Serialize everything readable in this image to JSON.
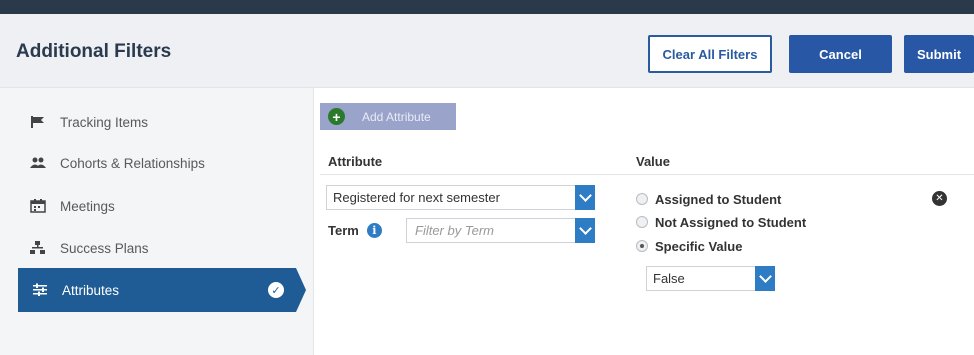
{
  "header": {
    "title": "Additional Filters",
    "clear_label": "Clear All Filters",
    "cancel_label": "Cancel",
    "submit_label": "Submit"
  },
  "sidebar": {
    "items": [
      {
        "label": "Tracking Items",
        "icon": "flag-icon"
      },
      {
        "label": "Cohorts & Relationships",
        "icon": "users-icon"
      },
      {
        "label": "Meetings",
        "icon": "calendar-icon"
      },
      {
        "label": "Success Plans",
        "icon": "org-chart-icon"
      }
    ],
    "active": {
      "label": "Attributes",
      "icon": "sliders-icon"
    }
  },
  "main": {
    "add_label": "Add Attribute",
    "attribute_header": "Attribute",
    "value_header": "Value",
    "attribute_select": "Registered for next semester",
    "term_label": "Term",
    "term_placeholder": "Filter by Term",
    "radios": [
      {
        "label": "Assigned to Student",
        "checked": false
      },
      {
        "label": "Not Assigned to Student",
        "checked": false
      },
      {
        "label": "Specific Value",
        "checked": true
      }
    ],
    "value_select": "False"
  },
  "colors": {
    "primary": "#2757a5",
    "active_nav": "#1f5c96",
    "dropdown_arrow": "#2e7cc4",
    "add_button": "#9aa3c9"
  }
}
